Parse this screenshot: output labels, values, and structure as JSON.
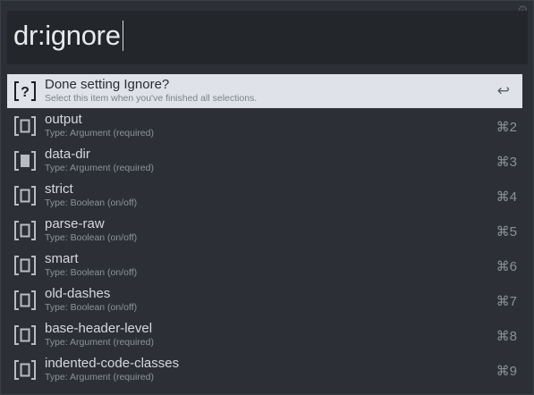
{
  "query": {
    "text": "dr:ignore"
  },
  "results": [
    {
      "title": "Done setting Ignore?",
      "subtitle": "Select this item when you've finished all selections.",
      "shortcut": "↩",
      "icon": "question-bracket-icon",
      "selected": true
    },
    {
      "title": "output",
      "subtitle": "Type: Argument (required)",
      "shortcut": "⌘2",
      "icon": "empty-bracket-icon"
    },
    {
      "title": "data-dir",
      "subtitle": "Type: Argument (required)",
      "shortcut": "⌘3",
      "icon": "filled-bracket-icon"
    },
    {
      "title": "strict",
      "subtitle": "Type: Boolean  (on/off)",
      "shortcut": "⌘4",
      "icon": "empty-bracket-icon"
    },
    {
      "title": "parse-raw",
      "subtitle": "Type: Boolean  (on/off)",
      "shortcut": "⌘5",
      "icon": "empty-bracket-icon"
    },
    {
      "title": "smart",
      "subtitle": "Type: Boolean  (on/off)",
      "shortcut": "⌘6",
      "icon": "empty-bracket-icon"
    },
    {
      "title": "old-dashes",
      "subtitle": "Type: Boolean  (on/off)",
      "shortcut": "⌘7",
      "icon": "empty-bracket-icon"
    },
    {
      "title": "base-header-level",
      "subtitle": "Type: Argument (required)",
      "shortcut": "⌘8",
      "icon": "empty-bracket-icon"
    },
    {
      "title": "indented-code-classes",
      "subtitle": "Type: Argument (required)",
      "shortcut": "⌘9",
      "icon": "empty-bracket-icon"
    }
  ],
  "colors": {
    "background": "#2c3036",
    "input_background": "#23272c",
    "selected_row": "#dfe2e8",
    "title_text": "#d5d8dc",
    "subtitle_text": "#8d939b"
  }
}
